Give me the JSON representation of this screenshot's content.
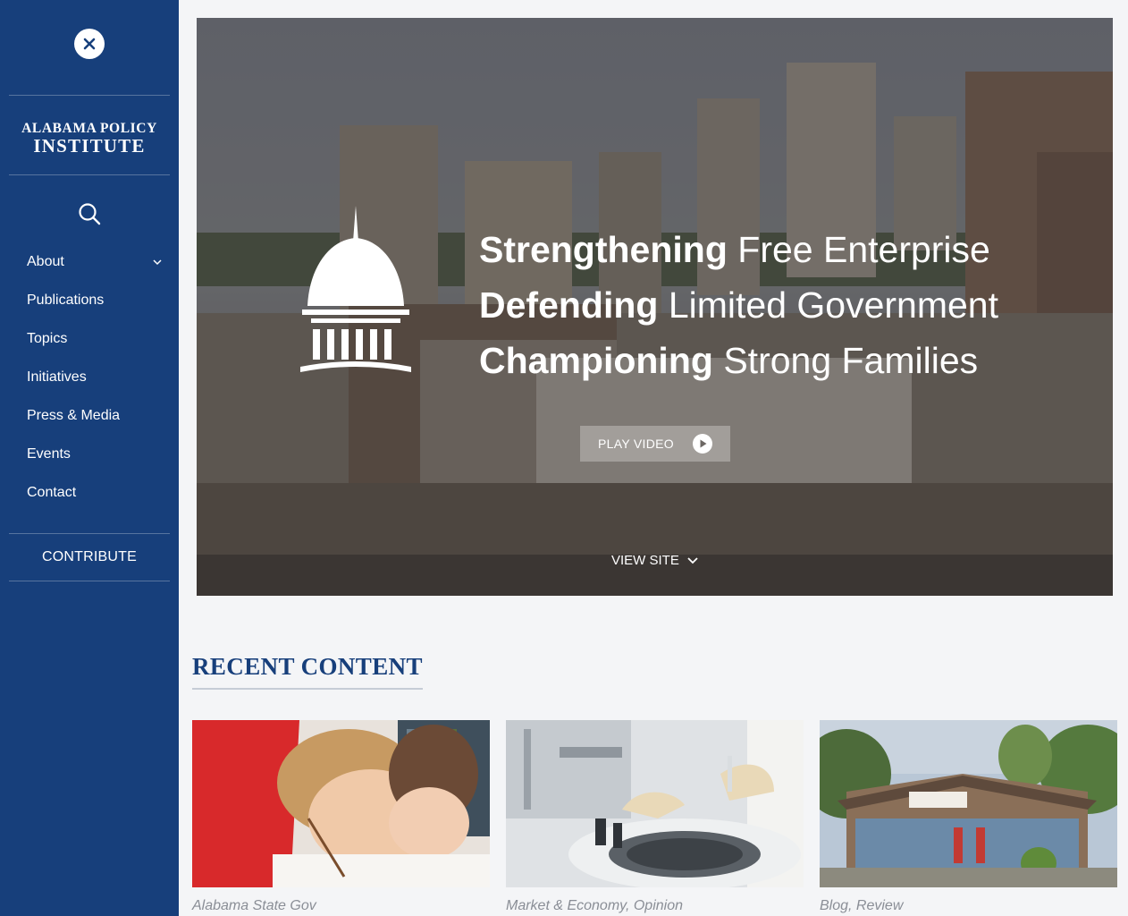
{
  "sidebar": {
    "logo_line1": "ALABAMA POLICY",
    "logo_line2": "INSTITUTE",
    "nav": [
      {
        "label": "About",
        "has_submenu": true
      },
      {
        "label": "Publications"
      },
      {
        "label": "Topics"
      },
      {
        "label": "Initiatives"
      },
      {
        "label": "Press & Media"
      },
      {
        "label": "Events"
      },
      {
        "label": "Contact"
      }
    ],
    "contribute_label": "CONTRIBUTE"
  },
  "hero": {
    "lines": [
      {
        "bold": "Strengthening",
        "light": "Free Enterprise"
      },
      {
        "bold": "Defending",
        "light": "Limited Government"
      },
      {
        "bold": "Championing",
        "light": "Strong Families"
      }
    ],
    "play_label": "PLAY VIDEO",
    "view_site_label": "VIEW SITE"
  },
  "recent": {
    "title": "RECENT CONTENT",
    "cards": [
      {
        "category": "Alabama State Gov",
        "image": "child-writing-photo"
      },
      {
        "category": "Market & Economy, Opinion",
        "image": "lab-centrifuge-photo"
      },
      {
        "category": "Blog, Review",
        "image": "country-store-photo"
      }
    ]
  },
  "colors": {
    "sidebar_bg": "#173f7b",
    "page_bg": "#f4f5f7",
    "heading": "#173f7b"
  }
}
